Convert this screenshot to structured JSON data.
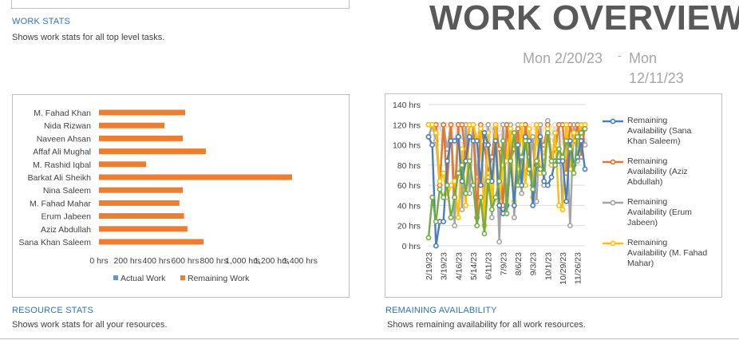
{
  "header": {
    "title": "WORK OVERVIEW",
    "date_start": "Mon 2/20/23",
    "date_sep": "-",
    "date_end_l1": "Mon",
    "date_end_l2": "12/11/23"
  },
  "sections": {
    "work_stats": {
      "title": "WORK STATS",
      "subtitle": "Shows work stats for all top level tasks."
    },
    "resource_stats": {
      "title": "RESOURCE STATS",
      "subtitle": "Shows work stats for all your resources."
    },
    "remaining_availability": {
      "title": "REMAINING AVAILABILITY",
      "subtitle": "Shows remaining availability for all work resources."
    }
  },
  "chart_data": [
    {
      "type": "bar",
      "orientation": "horizontal",
      "categories": [
        "M. Fahad Khan",
        "Nida Rizwan",
        "Naveen Ahsan",
        "Affaf Ali Mughal",
        "M. Rashid Iqbal",
        "Barkat Ali Sheikh",
        "Nina Saleem",
        "M. Fahad Mahar",
        "Erum Jabeen",
        "Aziz Abdullah",
        "Sana Khan Saleem"
      ],
      "series": [
        {
          "name": "Actual Work",
          "color": "#5b9bd5",
          "values": [
            0,
            0,
            0,
            0,
            0,
            0,
            0,
            0,
            0,
            0,
            0
          ]
        },
        {
          "name": "Remaining Work",
          "color": "#ed7d31",
          "values": [
            600,
            456,
            584,
            744,
            328,
            1344,
            584,
            560,
            592,
            616,
            728
          ]
        }
      ],
      "xlim": [
        0,
        1400
      ],
      "xticks": [
        "0 hrs",
        "200 hrs",
        "400 hrs",
        "600 hrs",
        "800 hrs",
        "1,000 hrs",
        "1,200 hrs",
        "1,400 hrs"
      ],
      "legend": "bottom"
    },
    {
      "type": "line",
      "x": [
        "2/19/23",
        "2/26/23",
        "3/5/23",
        "3/12/23",
        "3/19/23",
        "3/26/23",
        "4/2/23",
        "4/9/23",
        "4/16/23",
        "4/23/23",
        "4/30/23",
        "5/7/23",
        "5/14/23",
        "5/21/23",
        "5/28/23",
        "6/4/23",
        "6/11/23",
        "6/18/23",
        "6/25/23",
        "7/2/23",
        "7/9/23",
        "7/16/23",
        "7/23/23",
        "7/30/23",
        "8/6/23",
        "8/13/23",
        "8/20/23",
        "8/27/23",
        "9/3/23",
        "9/10/23",
        "9/17/23",
        "9/24/23",
        "10/1/23",
        "10/8/23",
        "10/15/23",
        "10/22/23",
        "10/29/23",
        "11/5/23",
        "11/12/23",
        "11/19/23",
        "11/26/23",
        "12/3/23",
        "12/10/23"
      ],
      "xtick_labels": [
        "2/19/23",
        "3/19/23",
        "4/16/23",
        "5/14/23",
        "6/11/23",
        "7/9/23",
        "8/6/23",
        "9/3/23",
        "10/1/23",
        "10/29/23",
        "11/26/23"
      ],
      "ylim": [
        0,
        140
      ],
      "yticks": [
        "0 hrs",
        "20 hrs",
        "40 hrs",
        "60 hrs",
        "80 hrs",
        "100 hrs",
        "120 hrs",
        "140 hrs"
      ],
      "legend": "right",
      "series": [
        {
          "name": "Remaining Availability (Sana Khan Saleem)",
          "color": "#4a7ebb",
          "values": [
            108,
            100,
            0,
            24,
            24,
            84,
            104,
            104,
            108,
            64,
            84,
            108,
            104,
            104,
            60,
            112,
            100,
            64,
            104,
            40,
            32,
            40,
            84,
            40,
            100,
            60,
            108,
            104,
            40,
            80,
            108,
            64,
            60,
            68,
            84,
            84,
            84,
            44,
            104,
            80,
            88,
            104,
            76
          ]
        },
        {
          "name": "Remaining Availability (Aziz Abdullah)",
          "color": "#e2782f",
          "values": [
            120,
            120,
            120,
            60,
            120,
            60,
            120,
            48,
            120,
            120,
            84,
            120,
            120,
            28,
            120,
            100,
            72,
            88,
            120,
            96,
            40,
            120,
            84,
            96,
            116,
            60,
            120,
            88,
            60,
            120,
            100,
            100,
            120,
            88,
            96,
            120,
            120,
            72,
            120,
            104,
            120,
            88,
            120
          ]
        },
        {
          "name": "Remaining Availability (Erum Jabeen)",
          "color": "#a5a5a5",
          "values": [
            108,
            120,
            104,
            60,
            120,
            96,
            120,
            20,
            120,
            36,
            120,
            52,
            120,
            68,
            112,
            40,
            120,
            28,
            116,
            4,
            120,
            40,
            120,
            28,
            120,
            52,
            120,
            72,
            108,
            44,
            120,
            60,
            124,
            80,
            104,
            120,
            36,
            120,
            20,
            120,
            84,
            120,
            100
          ]
        },
        {
          "name": "Remaining Availability (M. Fahad Mahar)",
          "color": "#ffc000",
          "values": [
            120,
            120,
            112,
            64,
            72,
            48,
            60,
            64,
            28,
            96,
            40,
            120,
            120,
            104,
            116,
            20,
            112,
            36,
            120,
            44,
            80,
            84,
            116,
            44,
            76,
            120,
            60,
            116,
            48,
            120,
            72,
            88,
            116,
            80,
            112,
            40,
            36,
            120,
            76,
            112,
            104,
            120,
            120
          ]
        },
        {
          "name": "Remaining Availability",
          "color": "#70ad47",
          "values": [
            8,
            48,
            24,
            56,
            48,
            60,
            28,
            48,
            72,
            80,
            52,
            84,
            60,
            20,
            48,
            12,
            64,
            36,
            48,
            64,
            104,
            32,
            84,
            112,
            60,
            88,
            104,
            76,
            56,
            84,
            76,
            72,
            112,
            84,
            80,
            96,
            88,
            104,
            96,
            72,
            108,
            112,
            116
          ]
        },
        {
          "name": "Remaining Availability",
          "color": "#c9d9f0",
          "values": [
            108,
            112,
            108,
            120,
            104,
            96,
            112,
            104,
            120,
            104,
            96,
            112,
            100,
            104,
            120,
            116,
            108,
            120,
            92,
            112,
            104,
            120,
            96,
            112,
            104,
            120,
            100,
            116,
            108,
            104,
            120,
            96,
            112,
            108,
            120,
            104,
            112,
            100,
            120,
            108,
            96,
            112,
            104
          ]
        },
        {
          "name": "Remaining Availability",
          "color": "#fbe0c3",
          "values": [
            120,
            116,
            120,
            108,
            112,
            120,
            116,
            120,
            104,
            120,
            112,
            120,
            116,
            108,
            120,
            112,
            104,
            120,
            116,
            120,
            108,
            112,
            120,
            104,
            116,
            120,
            112,
            108,
            120,
            116,
            104,
            120,
            112,
            116,
            120,
            108,
            104,
            120,
            116,
            112,
            120,
            108,
            116
          ]
        }
      ]
    }
  ],
  "legends": {
    "bar": [
      "Actual Work",
      "Remaining Work"
    ],
    "line": [
      {
        "lines": [
          "Remaining",
          "Availability (Sana",
          "Khan Saleem)"
        ],
        "color": "#4a7ebb"
      },
      {
        "lines": [
          "Remaining",
          "Availability (Aziz",
          "Abdullah)"
        ],
        "color": "#e2782f"
      },
      {
        "lines": [
          "Remaining",
          "Availability (Erum",
          "Jabeen)"
        ],
        "color": "#a5a5a5"
      },
      {
        "lines": [
          "Remaining",
          "Availability (M. Fahad",
          "Mahar)"
        ],
        "color": "#ffc000"
      }
    ]
  }
}
